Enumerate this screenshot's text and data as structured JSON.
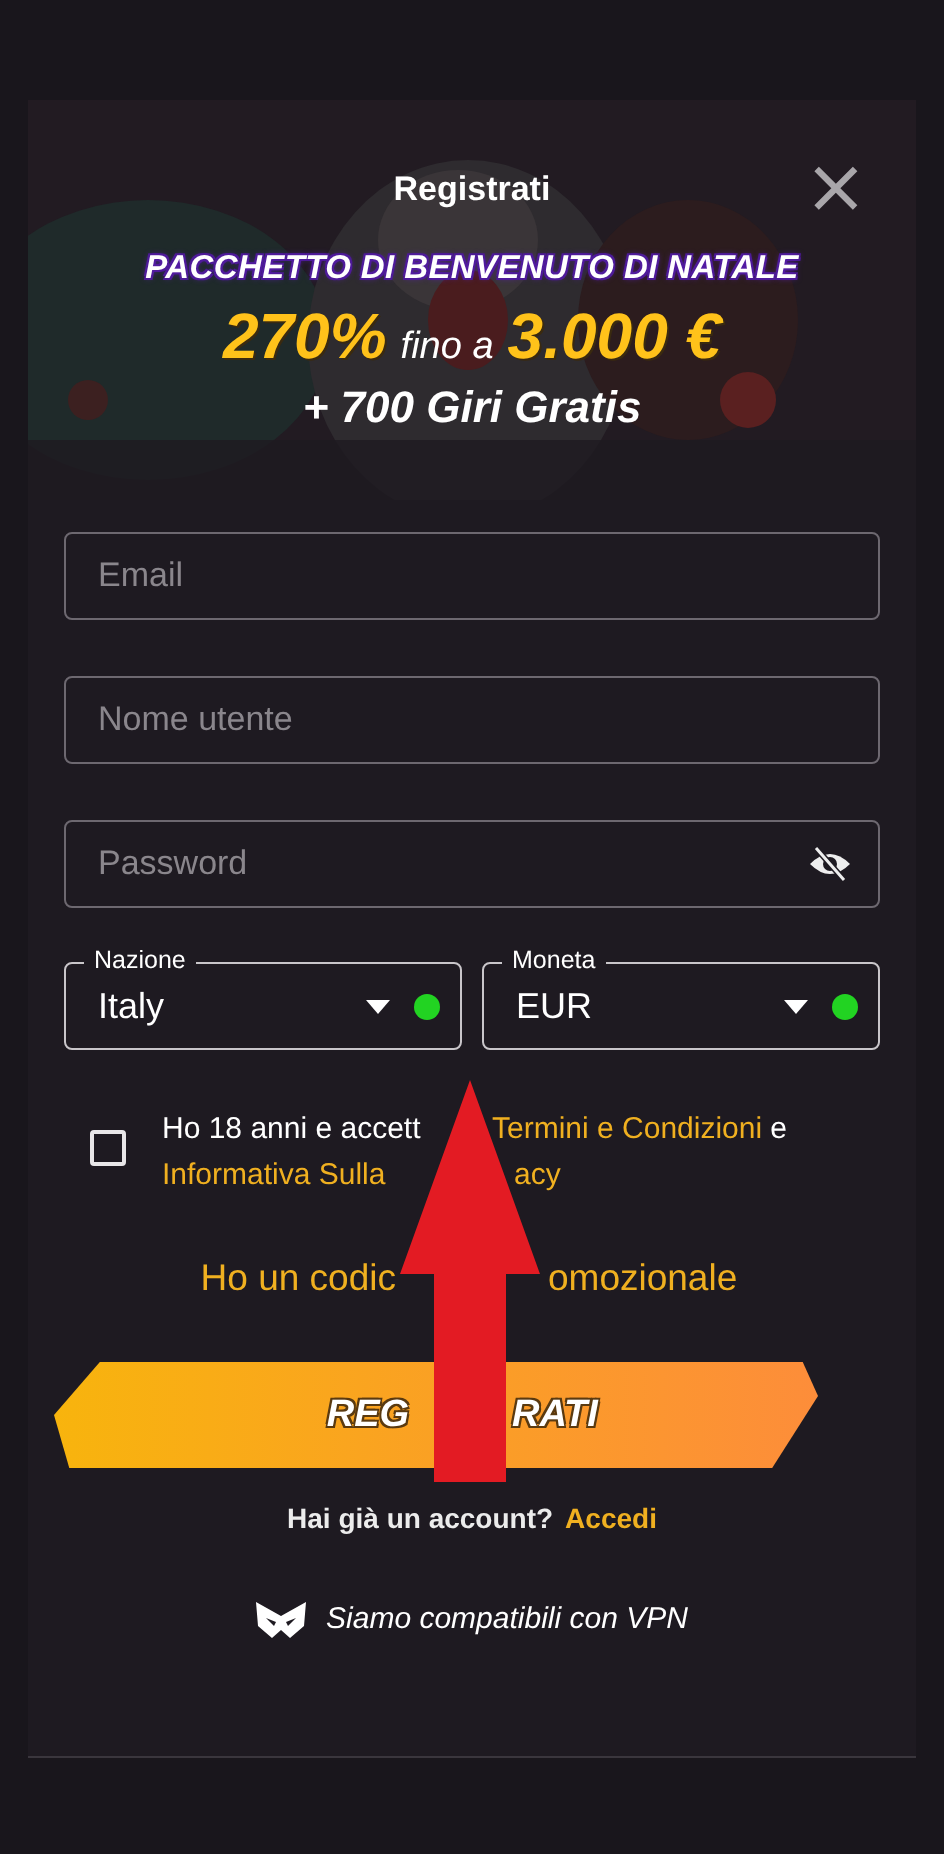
{
  "modal": {
    "title": "Registrati",
    "close": "×"
  },
  "promo_banner": {
    "headline": "PACCHETTO DI BENVENUTO DI NATALE",
    "percent": "270%",
    "connector": "fino a",
    "amount": "3.000 €",
    "extra": "+ 700 Giri Gratis"
  },
  "fields": [
    {
      "kind": "text",
      "placeholder": "Email"
    },
    {
      "kind": "text",
      "placeholder": "Nome utente"
    },
    {
      "kind": "password",
      "placeholder": "Password"
    }
  ],
  "selects": [
    {
      "label": "Nazione",
      "value": "Italy",
      "valid": true
    },
    {
      "label": "Moneta",
      "value": "EUR",
      "valid": true
    }
  ],
  "consent": {
    "checked": false,
    "line_1": {
      "before": "Ho 18 anni e accett",
      "link": "Termini e Condizioni",
      "after": "e"
    },
    "line_2": {
      "link_start": "Informativa Sulla",
      "link_end": "acy"
    }
  },
  "promo_code_link": {
    "start": "Ho un codic",
    "end": "omozionale"
  },
  "submit_button": {
    "start": "REG",
    "end": "RATI"
  },
  "login_prompt": {
    "text": "Hai già un account?",
    "link": "Accedi"
  },
  "vpn_note": "Siamo compatibili con VPN"
}
